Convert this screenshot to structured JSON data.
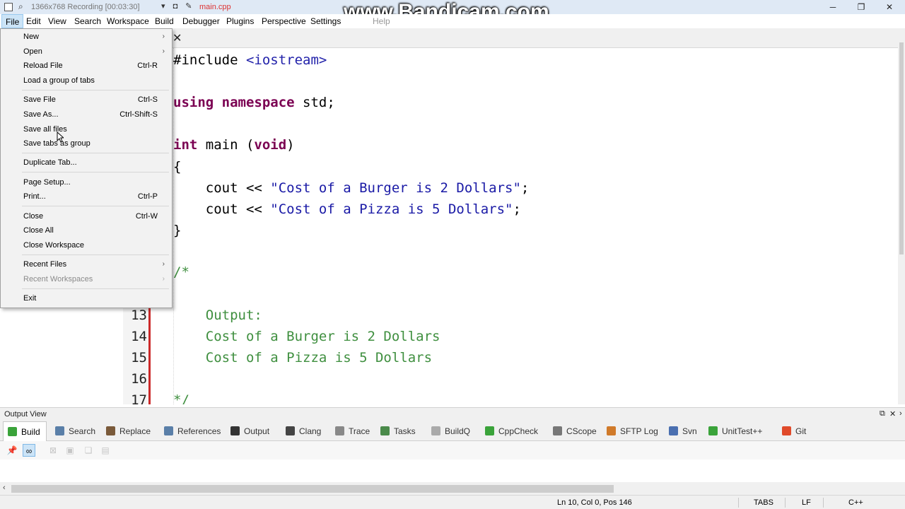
{
  "titlebar": {
    "recording_text": "1366x768  Recording [00:03:30]",
    "file_name": "main.cpp",
    "watermark": "www.Bandicam.com",
    "minimize": "─",
    "maximize": "❐",
    "close": "✕"
  },
  "menubar": {
    "items": [
      "File",
      "Edit",
      "View",
      "Search",
      "Workspace",
      "Build",
      "Debugger",
      "Plugins",
      "Perspective",
      "Settings",
      "Help"
    ]
  },
  "file_menu": {
    "items": [
      {
        "label": "New",
        "submenu": true
      },
      {
        "label": "Open",
        "submenu": true
      },
      {
        "label": "Reload File",
        "shortcut": "Ctrl-R"
      },
      {
        "label": "Load a group of tabs"
      },
      {
        "label": "Save File",
        "shortcut": "Ctrl-S"
      },
      {
        "label": "Save As...",
        "shortcut": "Ctrl-Shift-S"
      },
      {
        "label": "Save all files"
      },
      {
        "label": "Save tabs as group"
      },
      {
        "label": "Duplicate Tab..."
      },
      {
        "label": "Page Setup..."
      },
      {
        "label": "Print...",
        "shortcut": "Ctrl-P"
      },
      {
        "label": "Close",
        "shortcut": "Ctrl-W"
      },
      {
        "label": "Close All"
      },
      {
        "label": "Close Workspace"
      },
      {
        "label": "Recent Files",
        "submenu": true
      },
      {
        "label": "Recent Workspaces",
        "submenu": true,
        "disabled": true
      },
      {
        "label": "Exit"
      }
    ]
  },
  "editor": {
    "tab_close": "✕",
    "code": {
      "l1_kw": "#include ",
      "l1_inc": "<iostream>",
      "l3_kw": "using namespace",
      "l3_rest": " std;",
      "l5_kw1": "int",
      "l5_mid": " main (",
      "l5_kw2": "void",
      "l5_end": ")",
      "l6": "{",
      "l7_pre": "    cout << ",
      "l7_str": "\"Cost of a Burger is 2 Dollars\"",
      "l7_end": ";",
      "l8_pre": "    cout << ",
      "l8_str": "\"Cost of a Pizza is 5 Dollars\"",
      "l8_end": ";",
      "l9": "}",
      "l11": "/*",
      "l13": "    Output:",
      "l14": "    Cost of a Burger is 2 Dollars",
      "l15": "    Cost of a Pizza is 5 Dollars",
      "l17": "*/"
    },
    "line_numbers": [
      "13",
      "14",
      "15",
      "16",
      "17"
    ]
  },
  "output_view": {
    "title": "Output View",
    "tabs": [
      {
        "label": "Build",
        "icon": "build-icon",
        "color": "#3aa33a"
      },
      {
        "label": "Search",
        "icon": "search-icon",
        "color": "#5a7fa8"
      },
      {
        "label": "Replace",
        "icon": "replace-icon",
        "color": "#7a5a3a"
      },
      {
        "label": "References",
        "icon": "references-icon",
        "color": "#5a7fa8"
      },
      {
        "label": "Output",
        "icon": "output-icon",
        "color": "#333333"
      },
      {
        "label": "Clang",
        "icon": "clang-icon",
        "color": "#444444"
      },
      {
        "label": "Trace",
        "icon": "trace-icon",
        "color": "#888888"
      },
      {
        "label": "Tasks",
        "icon": "tasks-icon",
        "color": "#4a8a4a"
      },
      {
        "label": "BuildQ",
        "icon": "buildq-icon",
        "color": "#aaaaaa"
      },
      {
        "label": "CppCheck",
        "icon": "cppcheck-icon",
        "color": "#3aa33a"
      },
      {
        "label": "CScope",
        "icon": "cscope-icon",
        "color": "#777777"
      },
      {
        "label": "SFTP Log",
        "icon": "sftp-log-icon",
        "color": "#d07a2a"
      },
      {
        "label": "Svn",
        "icon": "svn-icon",
        "color": "#4a6fb0"
      },
      {
        "label": "UnitTest++",
        "icon": "unittest-icon",
        "color": "#3aa33a"
      },
      {
        "label": "Git",
        "icon": "git-icon",
        "color": "#e04a2a"
      }
    ]
  },
  "statusbar": {
    "position": "Ln 10, Col 0, Pos 146",
    "indent": "TABS",
    "eol": "LF",
    "language": "C++"
  }
}
